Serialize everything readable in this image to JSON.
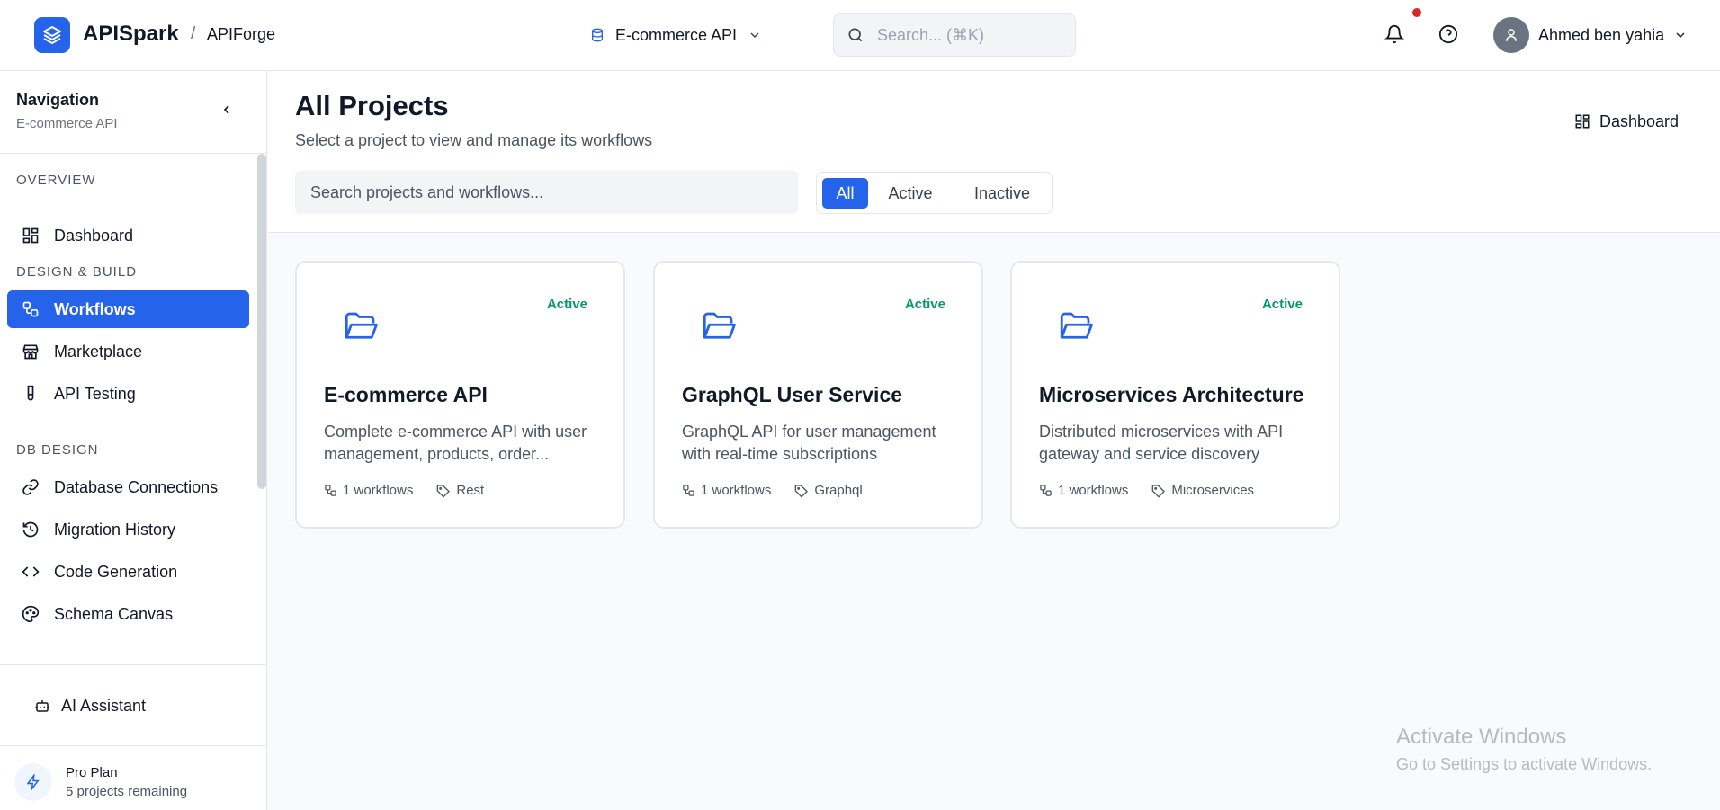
{
  "header": {
    "brand": "APISpark",
    "breadcrumb_sep": "/",
    "breadcrumb": "APIForge",
    "project_select": "E-commerce API",
    "search_placeholder": "Search... (⌘K)",
    "user_name": "Ahmed ben yahia"
  },
  "sidebar": {
    "title": "Navigation",
    "subtitle": "E-commerce API",
    "sections": {
      "overview": "OVERVIEW",
      "design_build": "DESIGN & BUILD",
      "db_design": "DB DESIGN"
    },
    "items": {
      "dashboard": "Dashboard",
      "workflows": "Workflows",
      "marketplace": "Marketplace",
      "api_testing": "API Testing",
      "db_connections": "Database Connections",
      "migration_history": "Migration History",
      "code_generation": "Code Generation",
      "schema_canvas": "Schema Canvas"
    },
    "active_item": "Workflows",
    "ai_assistant": "AI Assistant",
    "plan_name": "Pro Plan",
    "plan_remaining": "5 projects remaining"
  },
  "main": {
    "title": "All Projects",
    "subtitle": "Select a project to view and manage its workflows",
    "dashboard_button": "Dashboard",
    "search_placeholder": "Search projects and workflows...",
    "filters": [
      "All",
      "Active",
      "Inactive"
    ],
    "selected_filter": "All"
  },
  "projects": [
    {
      "title": "E-commerce API",
      "status": "Active",
      "description": "Complete e-commerce API with user management, products, order...",
      "workflows": "1 workflows",
      "tag": "Rest"
    },
    {
      "title": "GraphQL User Service",
      "status": "Active",
      "description": "GraphQL API for user management with real-time subscriptions",
      "workflows": "1 workflows",
      "tag": "Graphql"
    },
    {
      "title": "Microservices Architecture",
      "status": "Active",
      "description": "Distributed microservices with API gateway and service discovery",
      "workflows": "1 workflows",
      "tag": "Microservices"
    }
  ],
  "watermark": {
    "line1": "Activate Windows",
    "line2": "Go to Settings to activate Windows."
  },
  "colors": {
    "accent": "#2563eb",
    "status_active": "#059669",
    "notification": "#dc2626"
  }
}
